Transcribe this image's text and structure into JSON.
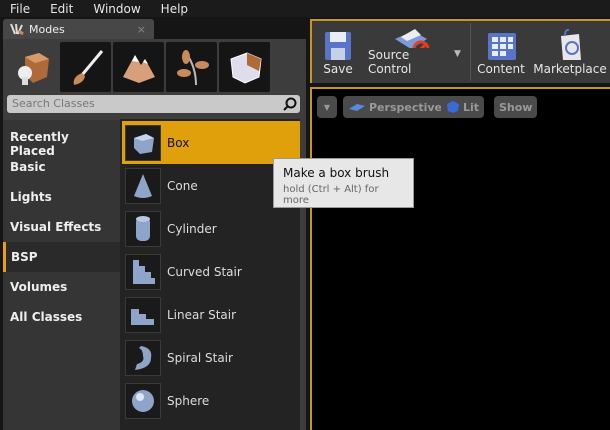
{
  "menu": [
    "File",
    "Edit",
    "Window",
    "Help"
  ],
  "modes_tab": {
    "title": "Modes",
    "close": "×"
  },
  "mode_buttons": [
    "place-mode",
    "paint-mode",
    "landscape-mode",
    "foliage-mode",
    "geometry-mode"
  ],
  "search": {
    "placeholder": "Search Classes"
  },
  "categories": [
    "Recently Placed",
    "Basic",
    "Lights",
    "Visual Effects",
    "BSP",
    "Volumes",
    "All Classes"
  ],
  "selected_category": "BSP",
  "items": [
    "Box",
    "Cone",
    "Cylinder",
    "Curved Stair",
    "Linear Stair",
    "Spiral Stair",
    "Sphere"
  ],
  "tooltip": {
    "title": "Make a box brush",
    "hint": "hold (Ctrl + Alt) for more"
  },
  "toolbar": {
    "save": "Save",
    "source_control": "Source Control",
    "content": "Content",
    "marketplace": "Marketplace"
  },
  "viewport": {
    "perspective": "Perspective",
    "lit": "Lit",
    "show": "Show"
  },
  "colors": {
    "accent": "#dfa00c"
  }
}
